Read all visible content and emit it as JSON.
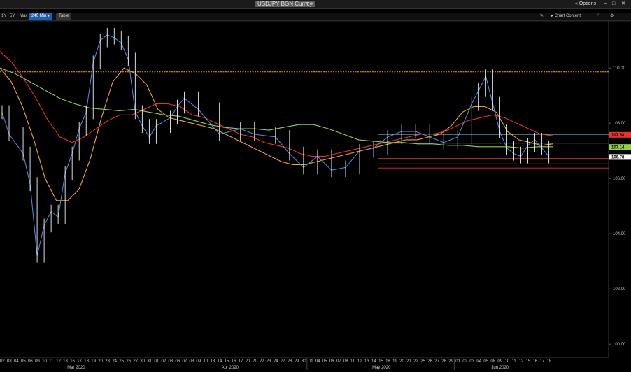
{
  "header": {
    "title": "USDJPY BGN Curncy",
    "options_label": "Options"
  },
  "toolbar": {
    "periods": [
      "1Y",
      "5Y",
      "Max"
    ],
    "interval": "240 Min",
    "table_label": "Table",
    "chart_content_label": "Chart Content"
  },
  "colors": {
    "price": "#4f8fe8",
    "ma_short": "#f5a623",
    "ma_mid": "#e8322e",
    "ma_long": "#8fd14f",
    "hline_orange": "#f5a623",
    "hline_red": "#e8322e",
    "hline_cyan": "#7fe0ff"
  },
  "chart_data": {
    "type": "line",
    "series_style": "candles",
    "ylim": [
      99.6,
      111.6
    ],
    "y_ticks": [
      "110.00",
      "108.00",
      "106.00",
      "104.00",
      "102.00",
      "100.00"
    ],
    "x_ticks": [
      "02",
      "03",
      "04",
      "05",
      "06",
      "09",
      "10",
      "11",
      "12",
      "13",
      "16",
      "17",
      "18",
      "19",
      "20",
      "23",
      "24",
      "25",
      "26",
      "27",
      "30",
      "31",
      "01",
      "02",
      "03",
      "06",
      "07",
      "08",
      "09",
      "10",
      "13",
      "14",
      "15",
      "16",
      "17",
      "20",
      "21",
      "22",
      "23",
      "24",
      "27",
      "28",
      "29",
      "30",
      "01",
      "04",
      "05",
      "06",
      "07",
      "08",
      "11",
      "12",
      "13",
      "14",
      "15",
      "18",
      "19",
      "20",
      "21",
      "22",
      "25",
      "26",
      "27",
      "28",
      "29",
      "01",
      "02",
      "03",
      "04",
      "05",
      "08",
      "09",
      "10",
      "11",
      "12",
      "15",
      "16",
      "17",
      "18"
    ],
    "months": [
      "Mar 2020",
      "Apr 2020",
      "May 2020",
      "Jun 2020"
    ],
    "price_tags": [
      {
        "label": "107.58",
        "value": 107.58,
        "color": "#e8322e"
      },
      {
        "label": "107.14",
        "value": 107.14,
        "color": "#8fd14f"
      },
      {
        "label": "106.78",
        "value": 106.78,
        "color": "#ffffff"
      }
    ],
    "horizontal_lines": [
      {
        "value": 109.86,
        "color": "#f5a623",
        "dashed": true
      },
      {
        "value": 107.6,
        "color": "#7fe0ff"
      },
      {
        "value": 107.28,
        "color": "#7fe0ff"
      },
      {
        "value": 106.72,
        "color": "#e8322e"
      },
      {
        "value": 106.53,
        "color": "#e8322e"
      },
      {
        "value": 106.38,
        "color": "#e8322e"
      }
    ],
    "price": {
      "name": "USDJPY",
      "x": [
        "2020-03-02",
        "2020-03-03",
        "2020-03-05",
        "2020-03-06",
        "2020-03-09",
        "2020-03-10",
        "2020-03-11",
        "2020-03-12",
        "2020-03-13",
        "2020-03-16",
        "2020-03-17",
        "2020-03-18",
        "2020-03-19",
        "2020-03-20",
        "2020-03-23",
        "2020-03-24",
        "2020-03-25",
        "2020-03-26",
        "2020-03-27",
        "2020-03-30",
        "2020-03-31",
        "2020-04-01",
        "2020-04-03",
        "2020-04-06",
        "2020-04-07",
        "2020-04-09",
        "2020-04-14",
        "2020-04-17",
        "2020-04-21",
        "2020-04-24",
        "2020-04-28",
        "2020-04-30",
        "2020-05-04",
        "2020-05-06",
        "2020-05-08",
        "2020-05-12",
        "2020-05-14",
        "2020-05-18",
        "2020-05-20",
        "2020-05-22",
        "2020-05-26",
        "2020-05-28",
        "2020-06-01",
        "2020-06-03",
        "2020-06-04",
        "2020-06-05",
        "2020-06-08",
        "2020-06-09",
        "2020-06-10",
        "2020-06-11",
        "2020-06-12",
        "2020-06-15",
        "2020-06-16",
        "2020-06-17",
        "2020-06-18"
      ],
      "values": [
        108.4,
        107.6,
        106.9,
        105.8,
        103.2,
        104.3,
        104.8,
        104.6,
        106.2,
        106.9,
        107.8,
        108.4,
        110.2,
        111.0,
        111.2,
        111.1,
        110.9,
        110.3,
        108.4,
        107.9,
        107.5,
        107.9,
        108.2,
        108.6,
        108.9,
        108.5,
        107.6,
        107.8,
        107.6,
        107.5,
        106.9,
        106.4,
        106.8,
        106.3,
        106.4,
        107.0,
        107.1,
        107.5,
        107.7,
        107.7,
        107.5,
        107.3,
        107.5,
        108.7,
        109.2,
        109.7,
        108.7,
        107.7,
        107.1,
        106.9,
        106.8,
        107.2,
        107.4,
        107.1,
        106.8
      ]
    },
    "series": [
      {
        "values": [
          110.0,
          109.5,
          108.6,
          107.4,
          106.0,
          105.2,
          105.2,
          105.6,
          106.7,
          108.2,
          109.5,
          110.0,
          109.8,
          109.4,
          108.5,
          108.2,
          108.1,
          108.0,
          107.9,
          107.8,
          107.6,
          107.4,
          107.2,
          107.0,
          106.8,
          106.6,
          106.5,
          106.5,
          106.6,
          106.7,
          106.8,
          106.9,
          107.0,
          107.1,
          107.2,
          107.3,
          107.4,
          107.4,
          107.5,
          107.6,
          107.9,
          108.4,
          108.6,
          108.6,
          108.4,
          107.7,
          107.4,
          107.3,
          107.2,
          107.25
        ]
      },
      {
        "values": [
          110.6,
          110.2,
          109.6,
          108.9,
          108.1,
          107.5,
          107.3,
          107.5,
          107.8,
          108.1,
          108.3,
          108.3,
          108.5,
          108.7,
          108.7,
          108.6,
          108.3,
          108.2,
          108.0,
          107.8,
          107.6,
          107.5,
          107.3,
          107.2,
          107.1,
          106.9,
          106.8,
          106.8,
          106.9,
          107.0,
          107.1,
          107.2,
          107.3,
          107.4,
          107.5,
          107.6,
          107.6,
          107.7,
          107.9,
          108.1,
          108.2,
          108.3,
          108.2,
          108.0,
          107.8,
          107.6,
          107.55
        ]
      },
      {
        "values": [
          110.0,
          109.8,
          109.5,
          109.2,
          108.9,
          108.7,
          108.55,
          108.5,
          108.45,
          108.5,
          108.4,
          108.3,
          108.25,
          108.1,
          107.95,
          107.85,
          107.8,
          107.8,
          107.75,
          107.85,
          107.95,
          107.95,
          107.8,
          107.6,
          107.4,
          107.35,
          107.3,
          107.3,
          107.25,
          107.25,
          107.2,
          107.2,
          107.15,
          107.15,
          107.15,
          107.1,
          107.15,
          107.15
        ]
      }
    ]
  }
}
